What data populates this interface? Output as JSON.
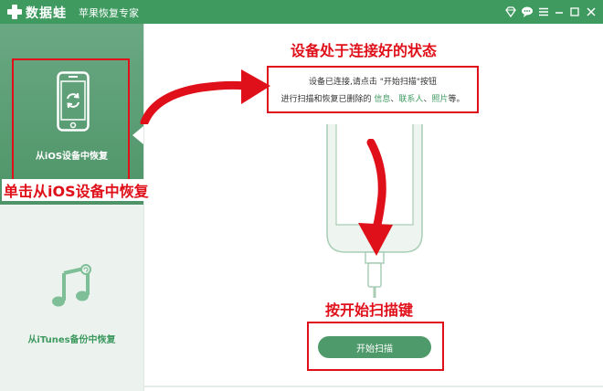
{
  "titlebar": {
    "brand": "数据蛙",
    "subtitle": "苹果恢复专家",
    "icons": [
      "diamond-icon",
      "chat-icon",
      "menu-icon",
      "minimize-icon",
      "maximize-icon",
      "close-icon"
    ]
  },
  "sidebar": {
    "items": [
      {
        "label": "从iOS设备中恢复",
        "icon": "phone-refresh-icon",
        "active": true
      },
      {
        "label": "从iTunes备份中恢复",
        "icon": "music-note-icon",
        "active": false
      }
    ]
  },
  "main": {
    "instruction_line1": "设备已连接,请点击 \"开始扫描\"按钮",
    "instruction_line2_prefix": "进行扫描和恢复已删除的 ",
    "highlight_items": [
      "信息",
      "联系人",
      "照片"
    ],
    "sep1": "、",
    "sep2": "、",
    "instruction_line2_suffix": "等。",
    "scan_button": "开始扫描"
  },
  "annotations": {
    "status": "设备处于连接好的状态",
    "click_ios": "单击从iOS设备中恢复",
    "press_scan": "按开始扫描键"
  },
  "colors": {
    "brand_green": "#3f9a60",
    "annotation_red": "#e0101a"
  }
}
